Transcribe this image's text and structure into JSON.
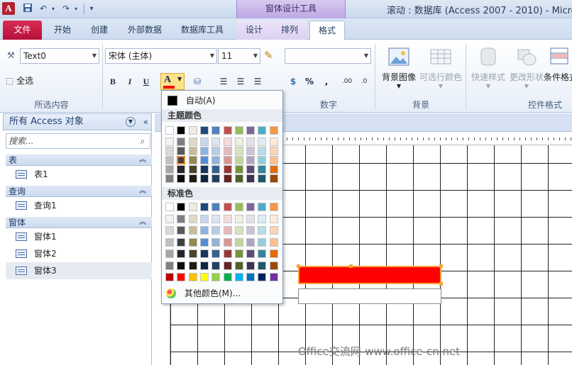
{
  "window": {
    "app_icon": "A",
    "context_tab_header": "窗体设计工具",
    "title": "滚动 : 数据库 (Access 2007 - 2010) - Micro"
  },
  "tabs": [
    {
      "label": "文件"
    },
    {
      "label": "开始"
    },
    {
      "label": "创建"
    },
    {
      "label": "外部数据"
    },
    {
      "label": "数据库工具"
    },
    {
      "label": "设计"
    },
    {
      "label": "排列"
    },
    {
      "label": "格式"
    }
  ],
  "ribbon": {
    "selection_combo": "Text0",
    "select_all_label": "全选",
    "group_selection_label": "所选内容",
    "font_name": "宋体 (主体)",
    "font_size": "11",
    "bold": "B",
    "italic": "I",
    "underline": "U",
    "font_color_letter": "A",
    "number_format": "",
    "percent": "%",
    "comma": ",",
    "group_number_label": "数字",
    "bg_image_label": "背景图像",
    "alt_row_color_label": "可选行颜色",
    "group_background_label": "背景",
    "quick_styles_label": "快速样式",
    "change_shape_label": "更改形状",
    "conditional_format_label": "条件格式",
    "group_control_format_label": "控件格式",
    "accent_red": "#ff0000"
  },
  "nav": {
    "title": "所有 Access 对象",
    "search_placeholder": "搜索...",
    "groups": [
      {
        "label": "表",
        "items": [
          "表1"
        ]
      },
      {
        "label": "查询",
        "items": [
          "查询1"
        ]
      },
      {
        "label": "窗体",
        "items": [
          "窗体1",
          "窗体2",
          "窗体3"
        ]
      }
    ]
  },
  "picker": {
    "auto_label": "自动(A)",
    "theme_title": "主题颜色",
    "standard_title": "标准色",
    "more_colors": "其他颜色(M)...",
    "theme_top": [
      "#ffffff",
      "#000000",
      "#eeece1",
      "#1f497d",
      "#4f81bd",
      "#c0504d",
      "#9bbb59",
      "#8064a2",
      "#4bacc6",
      "#f79646"
    ],
    "theme_shades": [
      [
        "#f2f2f2",
        "#7f7f7f",
        "#ddd9c3",
        "#c6d9f0",
        "#dbe5f1",
        "#f2dcdb",
        "#ebf1dd",
        "#e5e0ec",
        "#dbeef3",
        "#fdeada"
      ],
      [
        "#d8d8d8",
        "#595959",
        "#c4bd97",
        "#8db3e2",
        "#b8cce4",
        "#e5b9b7",
        "#d7e3bc",
        "#ccc1d9",
        "#b7dde8",
        "#fbd5b5"
      ],
      [
        "#bfbfbf",
        "#3f3f3f",
        "#938953",
        "#548dd4",
        "#95b3d7",
        "#d99694",
        "#c3d69b",
        "#b2a2c7",
        "#92cddc",
        "#fac08f"
      ],
      [
        "#a5a5a5",
        "#262626",
        "#494429",
        "#17365d",
        "#366092",
        "#953734",
        "#76923c",
        "#5f497a",
        "#31859b",
        "#e36c09"
      ],
      [
        "#7f7f7f",
        "#0c0c0c",
        "#1d1b10",
        "#0f243e",
        "#244061",
        "#632423",
        "#4f6128",
        "#3f3151",
        "#205867",
        "#974806"
      ]
    ],
    "standard_rows": [
      [
        "#ffffff",
        "#000000",
        "#eeece1",
        "#1f497d",
        "#4f81bd",
        "#c0504d",
        "#9bbb59",
        "#8064a2",
        "#4bacc6",
        "#f79646"
      ],
      [
        "#f2f2f2",
        "#7f7f7f",
        "#ddd9c3",
        "#c6d9f0",
        "#dbe5f1",
        "#f2dcdb",
        "#ebf1dd",
        "#e5e0ec",
        "#dbeef3",
        "#fdeada"
      ],
      [
        "#d8d8d8",
        "#595959",
        "#c4bd97",
        "#8db3e2",
        "#b8cce4",
        "#e5b9b7",
        "#d7e3bc",
        "#ccc1d9",
        "#b7dde8",
        "#fbd5b5"
      ],
      [
        "#bfbfbf",
        "#3f3f3f",
        "#938953",
        "#548dd4",
        "#95b3d7",
        "#d99694",
        "#c3d69b",
        "#b2a2c7",
        "#92cddc",
        "#fac08f"
      ],
      [
        "#a5a5a5",
        "#262626",
        "#494429",
        "#17365d",
        "#366092",
        "#953734",
        "#76923c",
        "#5f497a",
        "#31859b",
        "#e36c09"
      ],
      [
        "#7f7f7f",
        "#0c0c0c",
        "#1d1b10",
        "#0f243e",
        "#244061",
        "#632423",
        "#4f6128",
        "#3f3151",
        "#205867",
        "#974806"
      ],
      [
        "#c00000",
        "#ff0000",
        "#ffc000",
        "#ffff00",
        "#92d050",
        "#00b050",
        "#00b0f0",
        "#0070c0",
        "#002060",
        "#7030a0"
      ]
    ]
  },
  "watermark": "Office交流网-www.office-cn.net"
}
